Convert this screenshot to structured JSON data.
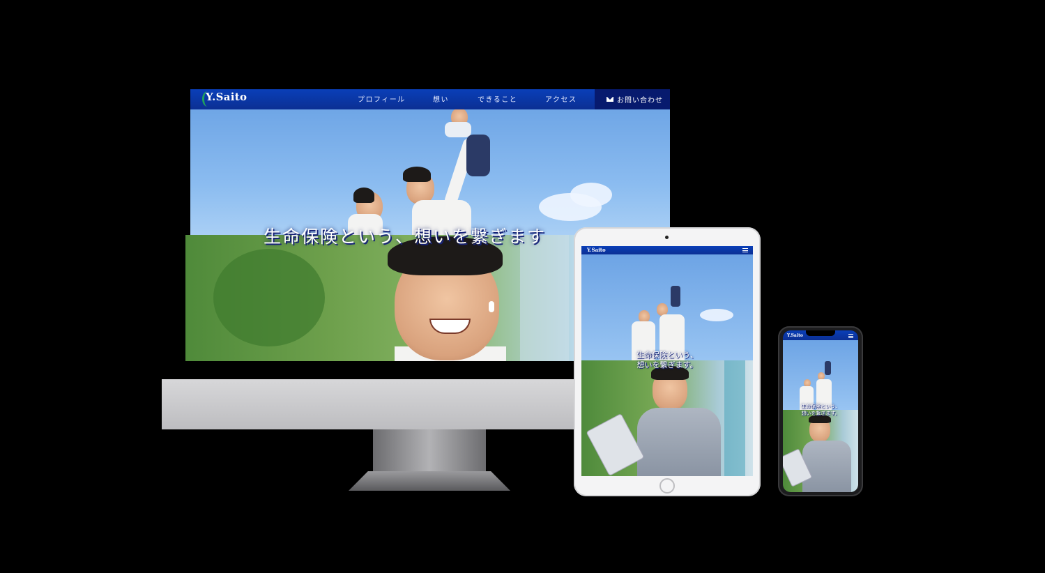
{
  "desktop": {
    "logo": "Y.Saito",
    "nav": {
      "profile": "プロフィール",
      "thoughts": "想い",
      "services": "できること",
      "access": "アクセス",
      "contact": "お問い合わせ"
    },
    "catchphrase": "生命保険という、想いを繋ぎます"
  },
  "tablet": {
    "logo": "Y.Saito",
    "catch_line1": "生命保険という、",
    "catch_line2": "想いを繋ぎます。"
  },
  "phone": {
    "logo": "Y.Saito",
    "catch_line1": "生命保険という、",
    "catch_line2": "想いを繋ぎます。"
  },
  "colors": {
    "nav_blue": "#0b2f93",
    "contact_navy": "#071a6e",
    "logo_green": "#1fa35b"
  }
}
